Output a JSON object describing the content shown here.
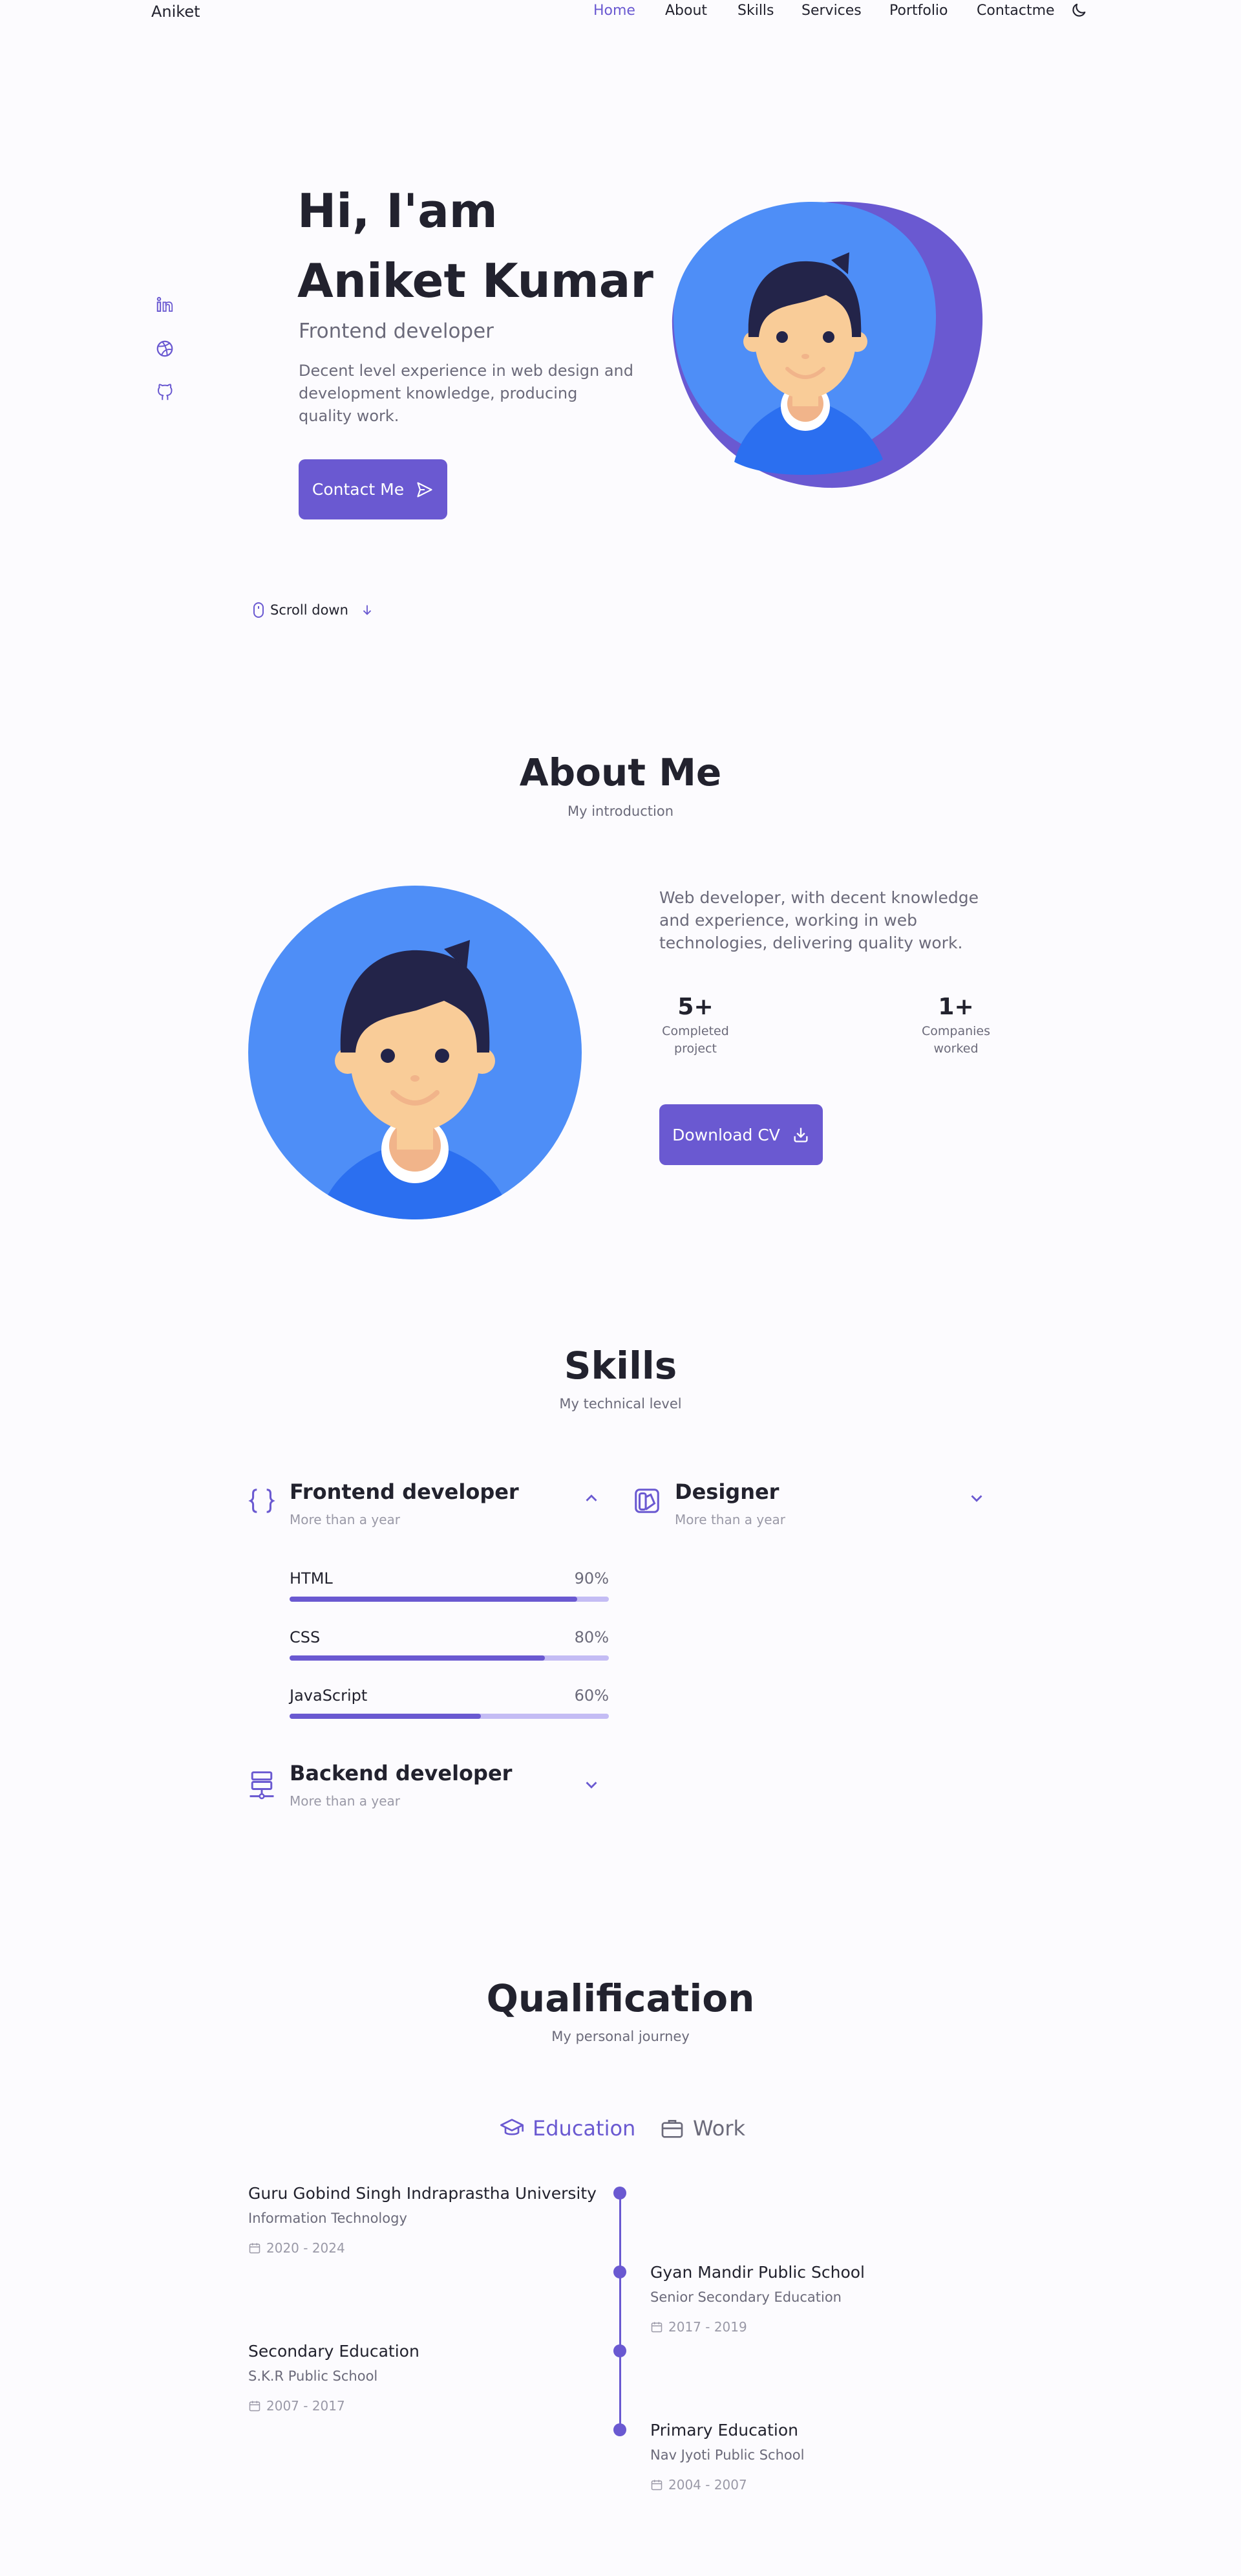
{
  "nav": {
    "logo": "Aniket",
    "links": [
      "Home",
      "About",
      "Skills",
      "Services",
      "Portfolio",
      "Contactme"
    ]
  },
  "home": {
    "greeting": "Hi, I'am",
    "name": "Aniket Kumar",
    "role": "Frontend developer",
    "description_lines": [
      "Decent level experience in web design and",
      "development knowledge, producing",
      "quality work."
    ],
    "contact_button": "Contact Me",
    "scroll_down": "Scroll down"
  },
  "about": {
    "title": "About Me",
    "subtitle": "My introduction",
    "description_lines": [
      "Web developer, with decent knowledge",
      "and experience, working in web",
      "technologies, delivering quality work."
    ],
    "stats": [
      {
        "value": "5+",
        "label_lines": [
          "Completed",
          "project"
        ]
      },
      {
        "value": "1+",
        "label_lines": [
          "Companies",
          "worked"
        ]
      }
    ],
    "download_button": "Download CV"
  },
  "skills": {
    "title": "Skills",
    "subtitle": "My technical level",
    "groups": [
      {
        "title": "Frontend developer",
        "subtitle": "More than a year",
        "expanded": true
      },
      {
        "title": "Designer",
        "subtitle": "More than a year",
        "expanded": false
      },
      {
        "title": "Backend developer",
        "subtitle": "More than a year",
        "expanded": false
      }
    ],
    "items": [
      {
        "name": "HTML",
        "percent": "90%",
        "level": 0.9
      },
      {
        "name": "CSS",
        "percent": "80%",
        "level": 0.8
      },
      {
        "name": "JavaScript",
        "percent": "60%",
        "level": 0.6
      }
    ]
  },
  "qualification": {
    "title": "Qualification",
    "subtitle": "My personal journey",
    "tabs": [
      "Education",
      "Work"
    ],
    "entries": [
      {
        "title": "Guru Gobind Singh Indraprastha University",
        "subtitle": "Information Technology",
        "date": "2020 - 2024"
      },
      {
        "title": "Gyan Mandir Public School",
        "subtitle": "Senior Secondary Education",
        "date": "2017 - 2019"
      },
      {
        "title": "Secondary Education",
        "subtitle": "S.K.R Public School",
        "date": "2007 - 2017"
      },
      {
        "title": "Primary Education",
        "subtitle": "Nav Jyoti Public School",
        "date": "2004 - 2007"
      }
    ]
  },
  "colors": {
    "accent": "#6a59d1",
    "accent_light": "#c4bcf4",
    "text": "#22222e",
    "muted": "#6b6a7a",
    "background": "#fcfbfe"
  }
}
